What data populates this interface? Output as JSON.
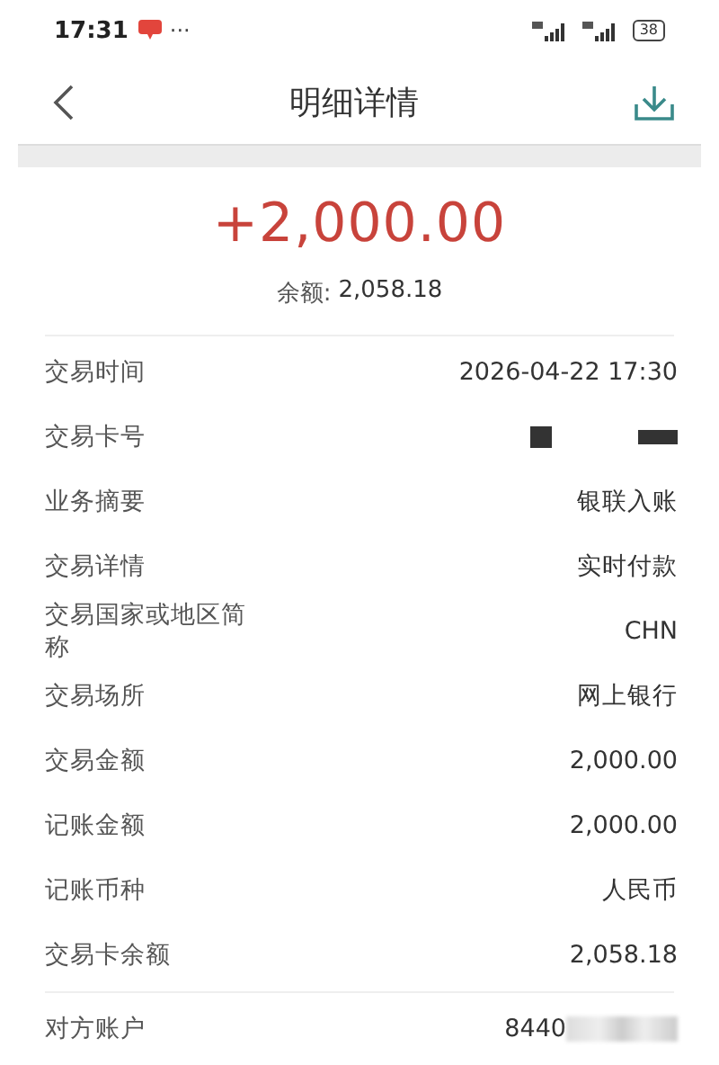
{
  "status_bar": {
    "time": "17:31",
    "dots": "···",
    "battery": "38"
  },
  "header": {
    "title": "明细详情"
  },
  "summary": {
    "amount": "+2,000.00",
    "balance_label": "余额:",
    "balance": "2,058.18"
  },
  "details": [
    {
      "label": "交易时间",
      "value": "2026-04-22 17:30",
      "masked": false
    },
    {
      "label": "交易卡号",
      "masked": true
    },
    {
      "label": "业务摘要",
      "value": "银联入账",
      "masked": false
    },
    {
      "label": "交易详情",
      "value": "实时付款",
      "masked": false
    },
    {
      "label": "交易国家或地区简称",
      "value": "CHN",
      "masked": false
    },
    {
      "label": "交易场所",
      "value": "网上银行",
      "masked": false
    },
    {
      "label": "交易金额",
      "value": "2,000.00",
      "masked": false
    },
    {
      "label": "记账金额",
      "value": "2,000.00",
      "masked": false
    },
    {
      "label": "记账币种",
      "value": "人民币",
      "masked": false
    },
    {
      "label": "交易卡余额",
      "value": "2,058.18",
      "masked": false
    }
  ],
  "counterparty": [
    {
      "label": "对方账户",
      "value": "8440",
      "masked": true
    }
  ]
}
